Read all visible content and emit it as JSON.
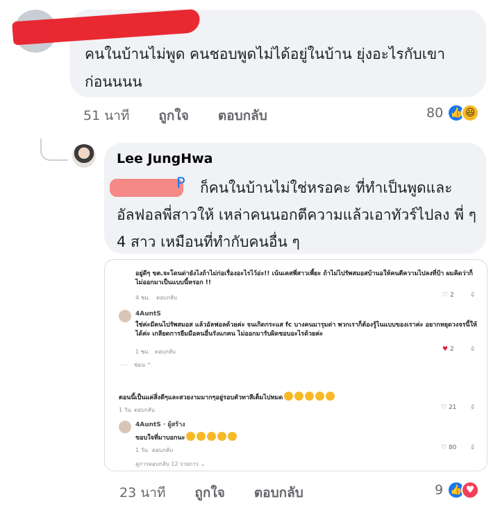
{
  "comment1": {
    "text": "คนในบ้านไม่พูด คนชอบพูดไม่ได้อยู่ในบ้าน ยุ่งอะไรกับเขาก่อนนนน",
    "time": "51 นาที",
    "like_label": "ถูกใจ",
    "reply_label": "ตอบกลับ",
    "reaction_count": "80",
    "reactions": [
      "like-icon",
      "haha-icon"
    ]
  },
  "reply": {
    "author": "Lee JungHwa",
    "mention_tail": "P",
    "text": "ก็คนในบ้านไม่ใช่หรอคะ ที่ทำเป็นพูดและอัลฟอลพี่สาวให้ เหล่าคนนอกตีความแล้วเอาทัวร์ไปลง พี่ ๆ 4 สาว  เหมือนที่ทำกับคนอื่น ๆ",
    "time": "23 นาที",
    "like_label": "ถูกใจ",
    "reply_label": "ตอบกลับ",
    "reaction_count": "9",
    "reactions": [
      "like-icon",
      "love-icon"
    ]
  },
  "screenshot": {
    "c1_text": "อยู่ดีๆ ขต.จะโดนด่ายังไงถ้าไม่ก่อเรื่องอะไรไว้อ่ะ!! เน้นเคสพี่สาวเพี้ยะ ถ้าไม่ไปรัพสมอสบ้านอให้คนตีความไปลงที่ป้า ผมคิดว่าก็ไม่ออกมาเป็นแบบนี้หรอก !!",
    "c1_time": "4 ชม.",
    "c1_reply": "ตอบกลับ",
    "c1_count": "2",
    "c2_author": "4AuntS",
    "c2_text": "ใช่ค่ะมีคนไปรัพสมอส แล้วอัลฟอลด้วยค่ะ จนเกิดกระแส fc บางคนมารุมด่า พวกเราก็ต้องรู้ไนแบบของเราค่ะ อยากหยุดวงจรนี้ให้ได้ค่ะ เกลียดการยืมมือคนอื่นรังแกคน ไม่ออกมารับผิดชอบอะไรด้วยค่ะ",
    "c2_time": "1 ชม.",
    "c2_reply": "ตอบกลับ",
    "c2_count": "2",
    "hide_label": "ซ่อน ^",
    "c3_text": "ตอนนี้เป็นแค่สิ่งดีๆและสวยงามมากๆอยู่รอบตัวทาสีเต็มไปหมด",
    "c3_time": "1 วัน",
    "c3_reply": "ตอบกลับ",
    "c3_count": "21",
    "c4_author": "4AuntS",
    "c4_badge": "· ผู้สร้าง",
    "c4_text": "ขอบใจที่มาบอกนะ",
    "c4_time": "1 วัน",
    "c4_reply": "ตอบกลับ",
    "c4_count": "80",
    "more_replies": "ดูการตอบกลับ 12 รายการ ⌄"
  }
}
